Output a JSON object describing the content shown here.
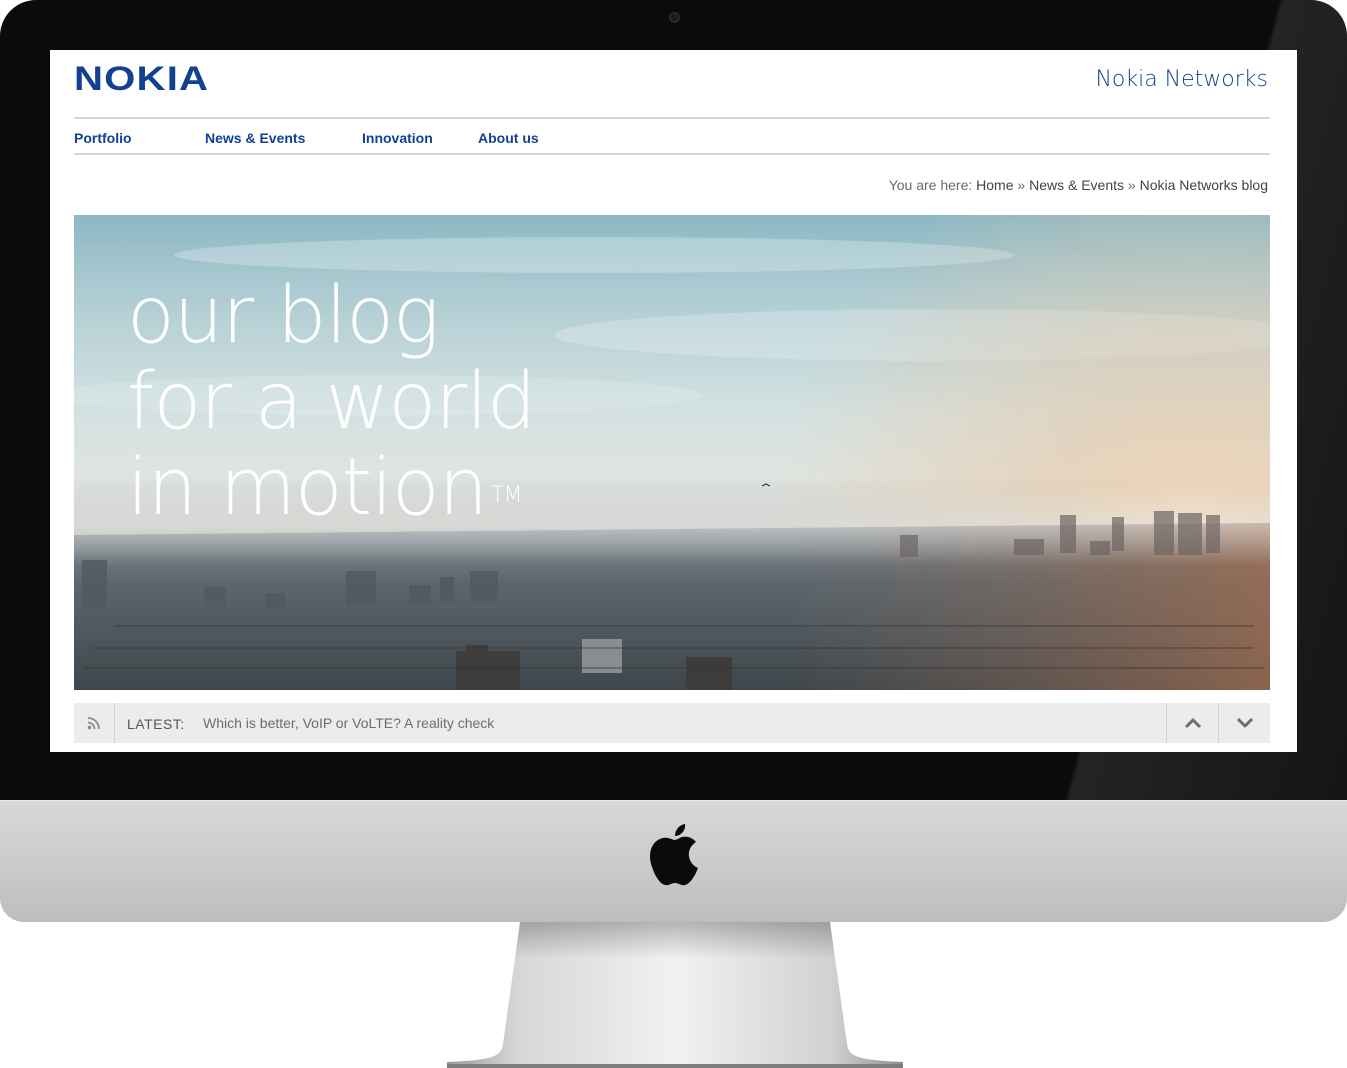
{
  "header": {
    "logo": "NOKIA",
    "site_title": "Nokia Networks"
  },
  "nav": [
    {
      "label": "Portfolio"
    },
    {
      "label": "News & Events"
    },
    {
      "label": "Innovation"
    },
    {
      "label": "About us"
    }
  ],
  "breadcrumb": {
    "prefix": "You are here:",
    "items": [
      "Home",
      "News & Events",
      "Nokia Networks blog"
    ],
    "separator": "»"
  },
  "hero": {
    "lines": [
      "our blog",
      "for a world",
      "in motion"
    ],
    "trademark": "TM"
  },
  "latest": {
    "label": "LATEST:",
    "headline": "Which is better, VoIP or VoLTE? A reality check"
  },
  "colors": {
    "brand": "#124191",
    "bar_bg": "#ebedec"
  },
  "icons": {
    "rss": "rss-icon",
    "up": "chevron-up-icon",
    "down": "chevron-down-icon",
    "apple": "apple-logo-icon"
  }
}
